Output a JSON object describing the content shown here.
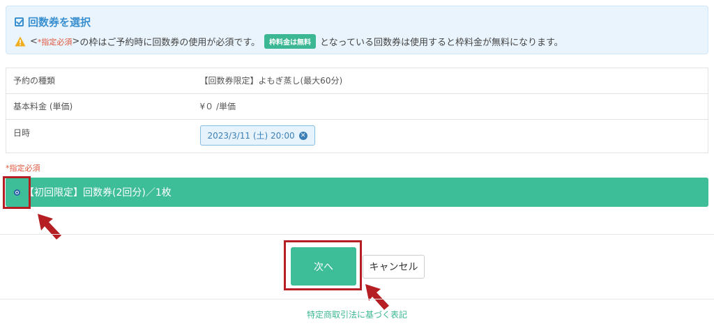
{
  "notice": {
    "title": "回数券を選択",
    "lt": "<",
    "required_tag": "*指定必須",
    "gt": ">",
    "text_before_badge": "の枠はご予約時に回数券の使用が必須です。",
    "badge": "枠料金は無料",
    "text_after_badge": "となっている回数券は使用すると枠料金が無料になります。"
  },
  "info": {
    "rows": [
      {
        "label": "予約の種類",
        "value": "【回数券限定】よもぎ蒸し(最大60分)"
      },
      {
        "label": "基本料金 (単価)",
        "value": "¥０ /単価"
      },
      {
        "label": "日時",
        "value": ""
      }
    ],
    "datetime_chip": "2023/3/11 (土) 20:00"
  },
  "required_label": "*指定必須",
  "ticket": {
    "label": "【初回限定】回数券(2回分)／1枚"
  },
  "actions": {
    "next": "次へ",
    "cancel": "キャンセル"
  },
  "footer": {
    "link": "特定商取引法に基づく表記"
  },
  "colors": {
    "accent": "#3dbd98",
    "highlight": "#b51f24",
    "info": "#3a8fd0"
  }
}
